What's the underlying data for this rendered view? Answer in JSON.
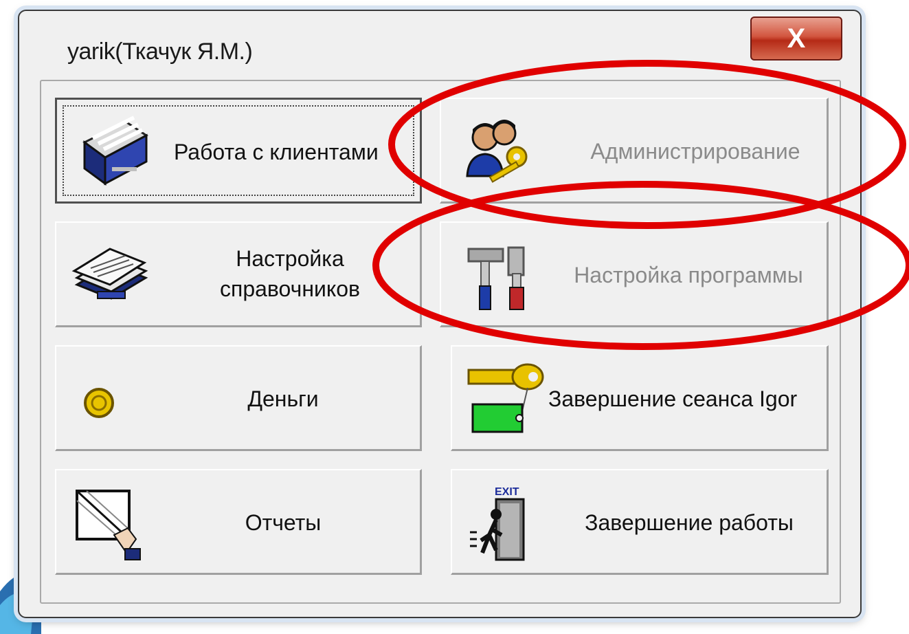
{
  "window": {
    "title": "yarik(Ткачук Я.М.)",
    "close_label": "X"
  },
  "buttons": {
    "clients": {
      "label": "Работа с клиентами",
      "icon": "card-file-icon",
      "selected": true
    },
    "admin": {
      "label": "Администрирование",
      "icon": "admin-users-key-icon",
      "enabled": false
    },
    "dictionaries": {
      "label_line1": "Настройка",
      "label_line2": "справочников",
      "icon": "books-icon"
    },
    "program_settings": {
      "label": "Настройка программы",
      "icon": "tools-icon",
      "enabled": false
    },
    "money": {
      "label": "Деньги",
      "icon": "coin-icon"
    },
    "end_session": {
      "label": "Завершение сеанса Igor",
      "icon": "key-tag-icon"
    },
    "reports": {
      "label": "Отчеты",
      "icon": "report-icon"
    },
    "exit": {
      "label": "Завершение работы",
      "icon": "exit-door-icon",
      "exit_sign": "EXIT"
    }
  },
  "colors": {
    "window_bg": "#f0f0f0",
    "annotation": "#e00000",
    "disabled_text": "#8a8a8a"
  }
}
